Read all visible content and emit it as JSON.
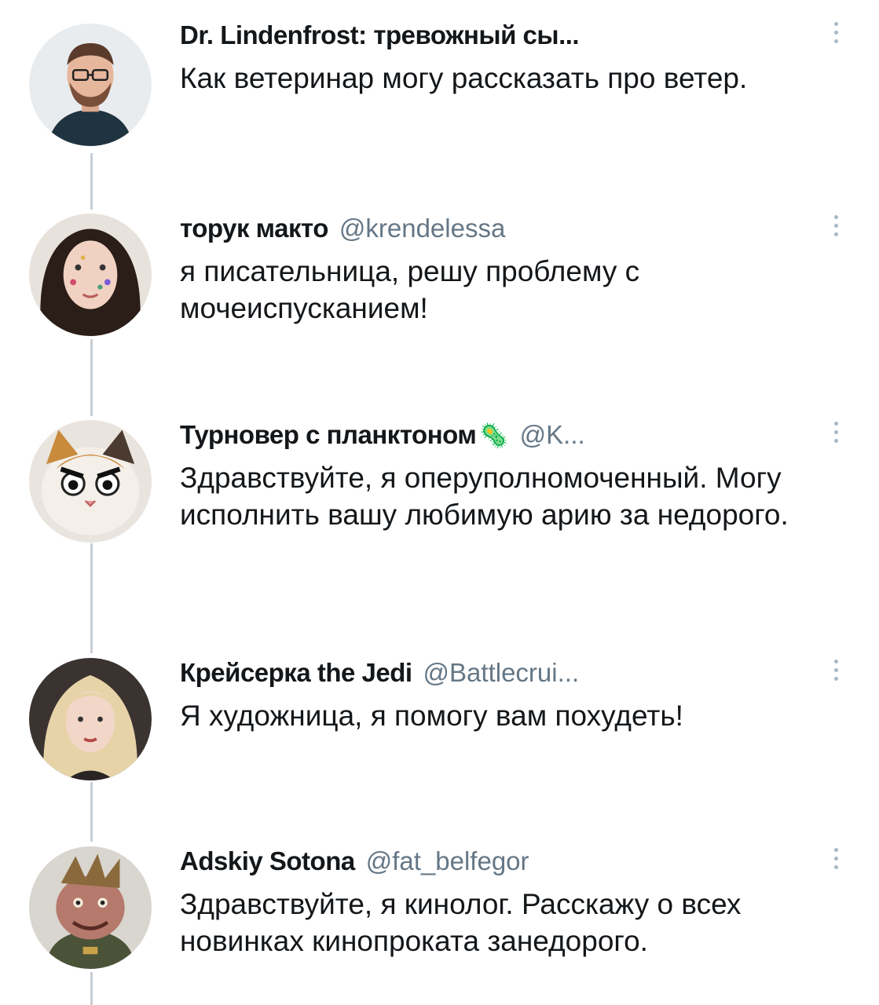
{
  "replies": [
    {
      "name": "Dr. Lindenfrost: тревожный сы...",
      "handle": "",
      "emoji": "",
      "text": "Как ветеринар могу рассказать про ветер.",
      "avatar": "bearded-man-with-glasses"
    },
    {
      "name": "торук макто",
      "handle": "@krendelessa",
      "emoji": "",
      "text": "я писательница, решу проблему с мочеиспусканием!",
      "avatar": "woman-with-flower-face-paint"
    },
    {
      "name": "Турновер с планктоном",
      "handle": "@K...",
      "emoji": "🦠",
      "text": "Здравствуйте, я оперуполномоченный. Могу исполнить вашу любимую арию за недорого.",
      "avatar": "angry-kitten"
    },
    {
      "name": "Крейсерка the Jedi",
      "handle": "@Battlecrui...",
      "emoji": "",
      "text": "Я художница, я помогу вам похудеть!",
      "avatar": "blonde-woman"
    },
    {
      "name": "Adskiy Sotona",
      "handle": "@fat_belfegor",
      "emoji": "",
      "text": "Здравствуйте, я кинолог. Расскажу о всех новинках кинопроката занедорого.",
      "avatar": "cartoon-general-character"
    }
  ],
  "colors": {
    "text": "#14171a",
    "secondary": "#657786",
    "thread_line": "#c8ced4"
  }
}
